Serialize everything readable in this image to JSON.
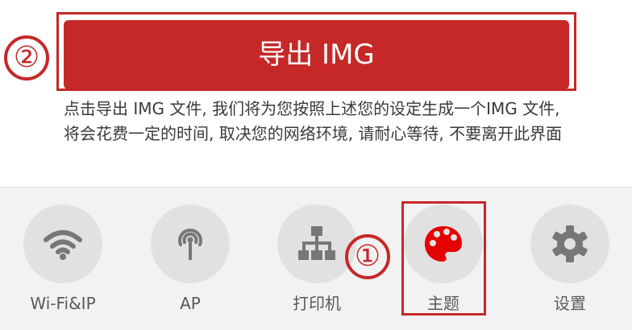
{
  "export": {
    "button_label": "导出 IMG",
    "description": "点击导出 IMG 文件, 我们将为您按照上述您的设定生成一个IMG 文件, 将会花费一定的时间, 取决您的网络环境, 请耐心等待, 不要离开此界面"
  },
  "annotations": {
    "step1": "①",
    "step2": "②"
  },
  "nav": {
    "items": [
      {
        "label": "Wi-Fi&IP",
        "icon": "wifi-icon"
      },
      {
        "label": "AP",
        "icon": "antenna-icon"
      },
      {
        "label": "打印机",
        "icon": "network-tree-icon"
      },
      {
        "label": "主题",
        "icon": "palette-icon",
        "active": true
      },
      {
        "label": "设置",
        "icon": "gear-icon"
      }
    ]
  },
  "colors": {
    "accent": "#c62828",
    "active_icon": "#e50000",
    "inactive_icon": "#777777",
    "nav_background": "#f2f2f2",
    "icon_circle": "#e1e1e1"
  }
}
